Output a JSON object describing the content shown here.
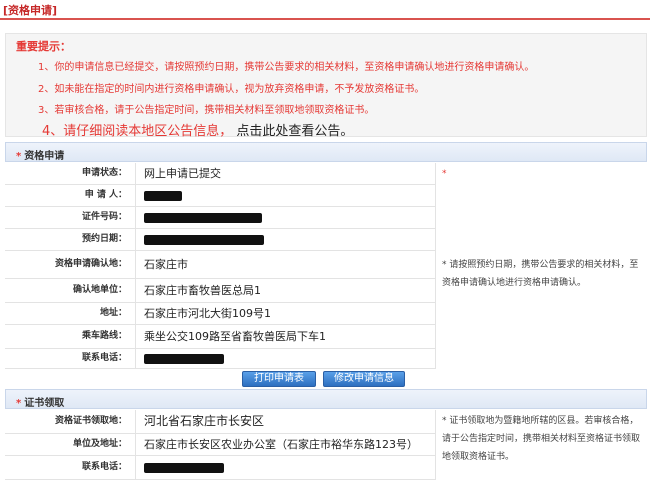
{
  "page": {
    "title": "[资格申请]"
  },
  "notice": {
    "heading": "重要提示：",
    "items": [
      "1、你的申请信息已经提交，请按照预约日期，携带公告要求的相关材料，至资格申请确认地进行资格申请确认。",
      "2、如未能在指定的时间内进行资格申请确认，视为放弃资格申请，不予发放资格证书。",
      "3、若审核合格，请于公告指定时间，携带相关材料至领取地领取资格证书。"
    ],
    "item4_prefix": "4、请仔细阅读本地区公告信息，",
    "item4_link": "点击此处查看公告。"
  },
  "apply": {
    "section_title": "资格申请",
    "rows": [
      {
        "label": "申请状态：",
        "value": "网上申请已提交"
      },
      {
        "label": "申 请 人：",
        "value": ""
      },
      {
        "label": "证件号码：",
        "value": ""
      },
      {
        "label": "预约日期：",
        "value": ""
      },
      {
        "label": "资格申请确认地：",
        "value": "石家庄市"
      },
      {
        "label": "确认地单位：",
        "value": "石家庄市畜牧兽医总局1"
      },
      {
        "label": "地址：",
        "value": "石家庄市河北大街109号1"
      },
      {
        "label": "乘车路线：",
        "value": "乘坐公交109路至省畜牧兽医局下车1"
      },
      {
        "label": "联系电话：",
        "value": ""
      }
    ],
    "side_star": "*",
    "side_note": "* 请按照预约日期，携带公告要求的相关材料，至资格申请确认地进行资格申请确认。"
  },
  "buttons": {
    "print": "打印申请表",
    "modify": "修改申请信息"
  },
  "cert": {
    "section_title": "证书领取",
    "rows": [
      {
        "label": "资格证书领取地：",
        "value": "河北省石家庄市长安区"
      },
      {
        "label": "单位及地址：",
        "value": "石家庄市长安区农业办公室（石家庄市裕华东路123号）"
      },
      {
        "label": "联系电话：",
        "value": ""
      }
    ],
    "side_note": "* 证书领取地为暨籍地所辖的区县。若审核合格，请于公告指定时间，携带相关材料至资格证书领取地领取资格证书。"
  },
  "colors": {
    "accent_red": "#e53935",
    "button_blue": "#2d6fc0"
  }
}
